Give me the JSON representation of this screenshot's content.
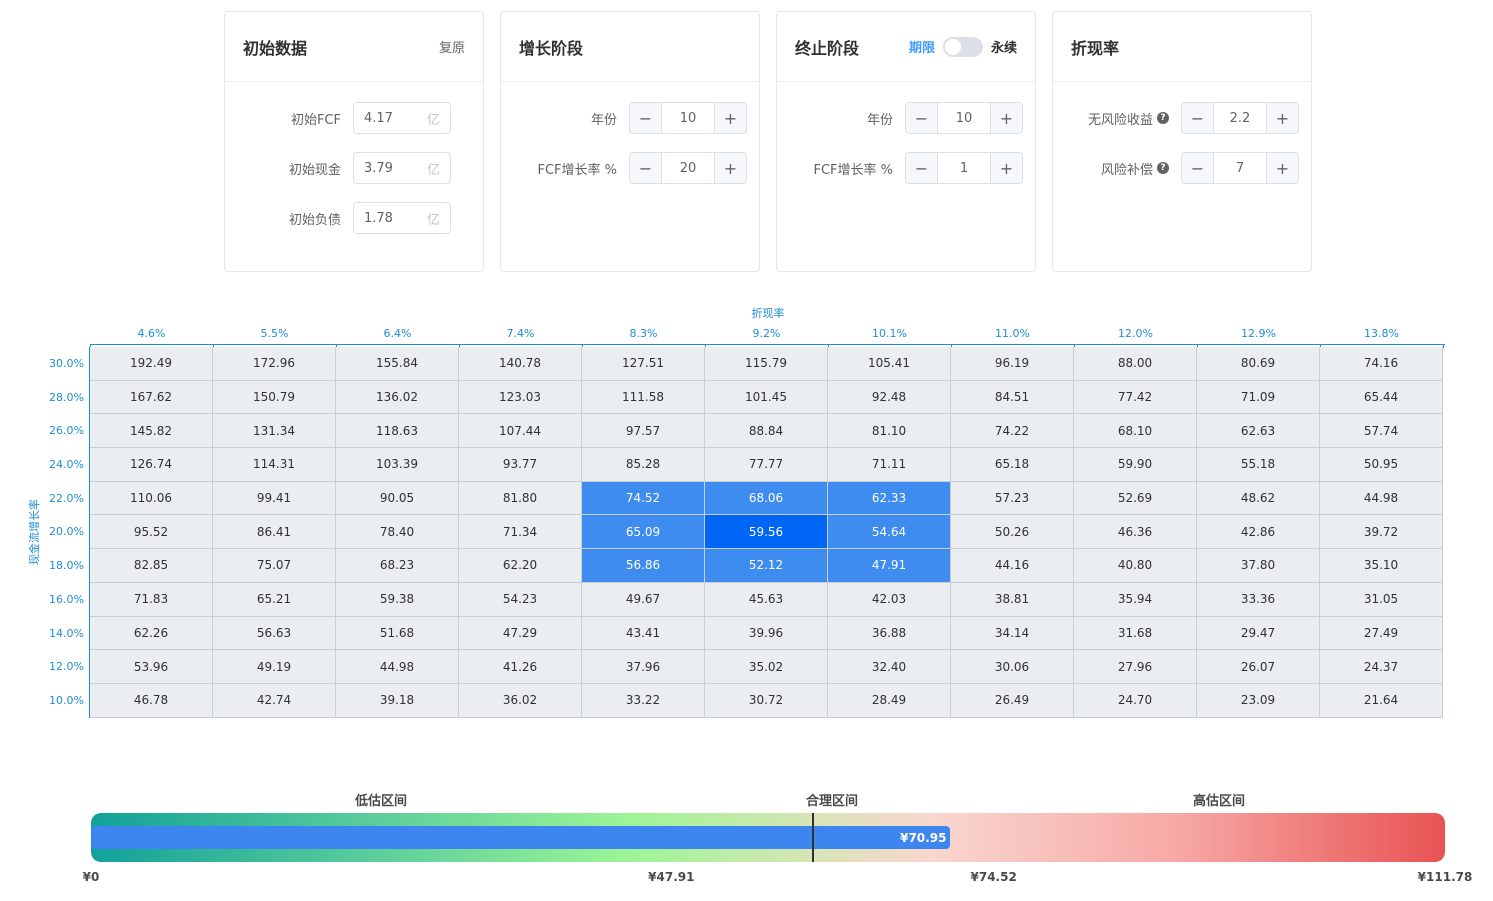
{
  "cards": {
    "initial": {
      "title": "初始数据",
      "reset_label": "复原",
      "fields": [
        {
          "label": "初始FCF",
          "value": "4.17",
          "unit": "亿"
        },
        {
          "label": "初始现金",
          "value": "3.79",
          "unit": "亿"
        },
        {
          "label": "初始负债",
          "value": "1.78",
          "unit": "亿"
        }
      ]
    },
    "growth": {
      "title": "增长阶段",
      "fields": [
        {
          "label": "年份",
          "value": "10"
        },
        {
          "label": "FCF增长率 %",
          "value": "20"
        }
      ]
    },
    "terminal": {
      "title": "终止阶段",
      "mode_left": "期限",
      "mode_right": "永续",
      "fields": [
        {
          "label": "年份",
          "value": "10"
        },
        {
          "label": "FCF增长率 %",
          "value": "1"
        }
      ]
    },
    "discount": {
      "title": "折现率",
      "fields": [
        {
          "label": "无风险收益",
          "value": "2.2"
        },
        {
          "label": "风险补偿",
          "value": "7"
        }
      ]
    }
  },
  "stepper": {
    "minus": "−",
    "plus": "+",
    "help": "?"
  },
  "chart_data": {
    "type": "heatmap",
    "xlabel": "折现率",
    "ylabel": "现金流增长率",
    "x": [
      "4.6%",
      "5.5%",
      "6.4%",
      "7.4%",
      "8.3%",
      "9.2%",
      "10.1%",
      "11.0%",
      "12.0%",
      "12.9%",
      "13.8%"
    ],
    "y": [
      "30.0%",
      "28.0%",
      "26.0%",
      "24.0%",
      "22.0%",
      "20.0%",
      "18.0%",
      "16.0%",
      "14.0%",
      "12.0%",
      "10.0%"
    ],
    "values": [
      [
        "192.49",
        "172.96",
        "155.84",
        "140.78",
        "127.51",
        "115.79",
        "105.41",
        "96.19",
        "88.00",
        "80.69",
        "74.16"
      ],
      [
        "167.62",
        "150.79",
        "136.02",
        "123.03",
        "111.58",
        "101.45",
        "92.48",
        "84.51",
        "77.42",
        "71.09",
        "65.44"
      ],
      [
        "145.82",
        "131.34",
        "118.63",
        "107.44",
        "97.57",
        "88.84",
        "81.10",
        "74.22",
        "68.10",
        "62.63",
        "57.74"
      ],
      [
        "126.74",
        "114.31",
        "103.39",
        "93.77",
        "85.28",
        "77.77",
        "71.11",
        "65.18",
        "59.90",
        "55.18",
        "50.95"
      ],
      [
        "110.06",
        "99.41",
        "90.05",
        "81.80",
        "74.52",
        "68.06",
        "62.33",
        "57.23",
        "52.69",
        "48.62",
        "44.98"
      ],
      [
        "95.52",
        "86.41",
        "78.40",
        "71.34",
        "65.09",
        "59.56",
        "54.64",
        "50.26",
        "46.36",
        "42.86",
        "39.72"
      ],
      [
        "82.85",
        "75.07",
        "68.23",
        "62.20",
        "56.86",
        "52.12",
        "47.91",
        "44.16",
        "40.80",
        "37.80",
        "35.10"
      ],
      [
        "71.83",
        "65.21",
        "59.38",
        "54.23",
        "49.67",
        "45.63",
        "42.03",
        "38.81",
        "35.94",
        "33.36",
        "31.05"
      ],
      [
        "62.26",
        "56.63",
        "51.68",
        "47.29",
        "43.41",
        "39.96",
        "36.88",
        "34.14",
        "31.68",
        "29.47",
        "27.49"
      ],
      [
        "53.96",
        "49.19",
        "44.98",
        "41.26",
        "37.96",
        "35.02",
        "32.40",
        "30.06",
        "27.96",
        "26.07",
        "24.37"
      ],
      [
        "46.78",
        "42.74",
        "39.18",
        "36.02",
        "33.22",
        "30.72",
        "28.49",
        "26.49",
        "24.70",
        "23.09",
        "21.64"
      ]
    ],
    "highlight": {
      "rows": [
        4,
        5,
        6
      ],
      "cols": [
        4,
        5,
        6
      ],
      "center": [
        5,
        5
      ]
    },
    "colors": {
      "cell": "#eaeef0",
      "zone": "#3f8cf0",
      "center": "#0066f5",
      "axis": "#1f8dd6"
    }
  },
  "valuation": {
    "zones": [
      "低估区间",
      "合理区间",
      "高估区间"
    ],
    "current_label": "¥70.95",
    "current": 70.95,
    "marker": 59.56,
    "min": 0,
    "max": 111.78,
    "ticks": [
      {
        "label": "¥0",
        "value": 0
      },
      {
        "label": "¥47.91",
        "value": 47.91
      },
      {
        "label": "¥74.52",
        "value": 74.52
      },
      {
        "label": "¥111.78",
        "value": 111.78
      }
    ]
  }
}
